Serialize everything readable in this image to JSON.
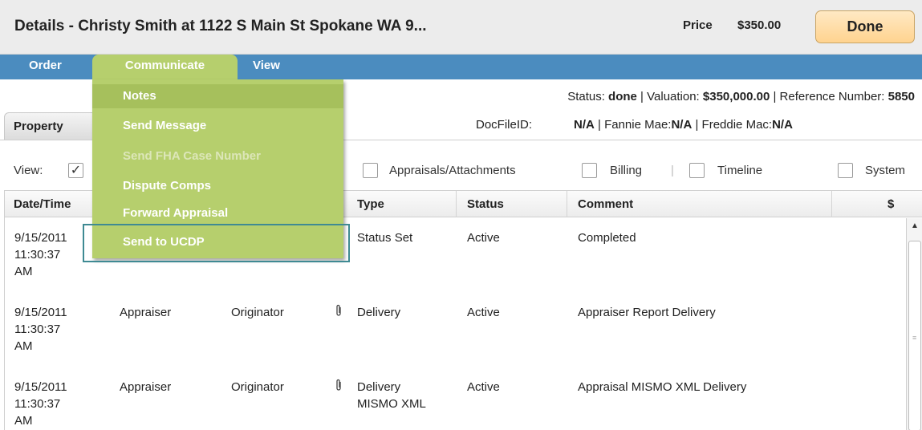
{
  "header": {
    "title": "Details - Christy Smith at 1122 S Main St Spokane  WA 9...",
    "price_label": "Price",
    "price_value": "$350.00",
    "done_label": "Done"
  },
  "menu": {
    "order": "Order",
    "communicate": "Communicate",
    "view": "View"
  },
  "dropdown": {
    "items": [
      {
        "label": "Notes",
        "state": "highlighted"
      },
      {
        "label": "Send Message",
        "state": "enabled"
      },
      {
        "label": "Send FHA Case Number",
        "state": "disabled"
      },
      {
        "label": "Dispute Comps",
        "state": "enabled"
      },
      {
        "label": "Forward Appraisal",
        "state": "enabled"
      },
      {
        "label": "Send to UCDP",
        "state": "enabled"
      }
    ]
  },
  "status": {
    "status_label": "Status: ",
    "status_value": "done",
    "valuation_label": " | Valuation: ",
    "valuation_value": "$350,000.00",
    "reference_label": " | Reference Number: ",
    "reference_value": "5850"
  },
  "docfile": {
    "label": "DocFileID:",
    "docfile_value": "N/A",
    "fannie_label": " | Fannie Mae:",
    "fannie_value": "N/A",
    "freddie_label": " | Freddie Mac:",
    "freddie_value": "N/A"
  },
  "tabs": {
    "property": "Property"
  },
  "view_filters": {
    "label": "View:",
    "appraisals": "Appraisals/Attachments",
    "billing": "Billing",
    "timeline": "Timeline",
    "system": "System",
    "checked_mark": "✓",
    "separator": "|"
  },
  "table": {
    "columns": {
      "datetime": "Date/Time",
      "type": "Type",
      "status": "Status",
      "comment": "Comment",
      "amount": "$"
    },
    "rows": [
      {
        "date": "9/15/2011",
        "time": "11:30:37",
        "ampm": "AM",
        "from": "",
        "to": "",
        "type1": "Status Set",
        "type2": "",
        "status": "Active",
        "comment": "Completed",
        "attachment": false
      },
      {
        "date": "9/15/2011",
        "time": "11:30:37",
        "ampm": "AM",
        "from": "Appraiser",
        "to": "Originator",
        "type1": "Delivery",
        "type2": "",
        "status": "Active",
        "comment": "Appraiser Report Delivery",
        "attachment": true
      },
      {
        "date": "9/15/2011",
        "time": "11:30:37",
        "ampm": "AM",
        "from": "Appraiser",
        "to": "Originator",
        "type1": "Delivery",
        "type2": "MISMO XML",
        "status": "Active",
        "comment": "Appraisal MISMO XML Delivery",
        "attachment": true
      }
    ]
  },
  "icons": {
    "attachment": "paperclip-icon",
    "scroll_up": "arrow-up-icon"
  },
  "colors": {
    "menubar": "#4b8cbf",
    "menu_active": "#b6cf6d",
    "menu_highlight": "#a6c05c",
    "done_button": "#ffd38f",
    "focus_outline": "#3f8a93"
  }
}
